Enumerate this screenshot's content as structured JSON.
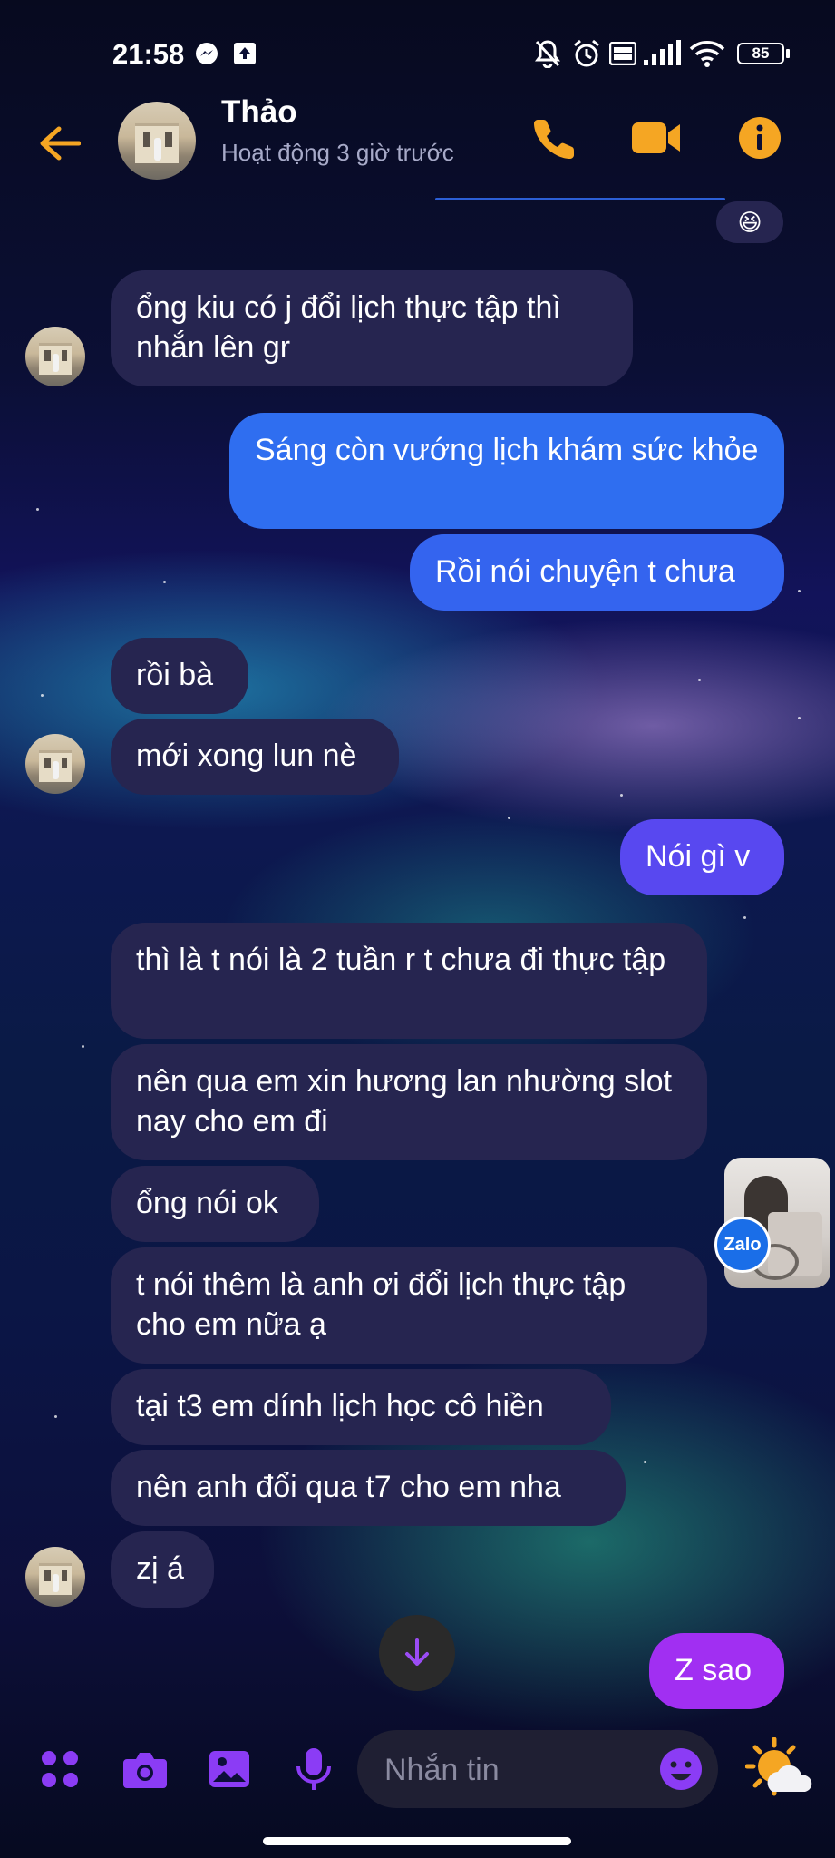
{
  "status_bar": {
    "time": "21:58",
    "icons": [
      "messenger-icon",
      "upload-icon",
      "bell-off-icon",
      "alarm-icon",
      "volte-icon",
      "signal-icon",
      "wifi-icon"
    ],
    "battery": "85"
  },
  "header": {
    "contact_name": "Thảo",
    "activity": "Hoạt động 3 giờ trước",
    "icons": [
      "back-arrow-icon",
      "phone-icon",
      "video-camera-icon",
      "info-icon"
    ],
    "accent_color": "#f5a623"
  },
  "messages": [
    {
      "side": "in",
      "text": "ổng kiu có j đổi lịch thực tập thì nhắn lên gr"
    },
    {
      "side": "out",
      "text": "Sáng còn vướng lịch khám sức khỏe"
    },
    {
      "side": "out",
      "text": "Rồi nói chuyện t chưa"
    },
    {
      "side": "in",
      "text": "rồi bà"
    },
    {
      "side": "in",
      "text": "mới xong lun nè"
    },
    {
      "side": "out",
      "text": "Nói gì v"
    },
    {
      "side": "in",
      "text": "thì là t nói là 2 tuần r t chưa đi thực tập"
    },
    {
      "side": "in",
      "text": "nên qua em xin hương lan nhường slot nay cho em đi"
    },
    {
      "side": "in",
      "text": "ổng nói ok"
    },
    {
      "side": "in",
      "text": "t nói thêm là anh ơi đổi lịch thực tập cho em nữa ạ"
    },
    {
      "side": "in",
      "text": "tại t3 em dính lịch học cô hiền"
    },
    {
      "side": "in",
      "text": "nên anh đổi qua t7 cho em nha"
    },
    {
      "side": "in",
      "text": "zị á"
    },
    {
      "side": "out",
      "text": "Z sao"
    }
  ],
  "reaction": "😆",
  "zalo_badge": "Zalo",
  "composer": {
    "placeholder": "Nhắn tin",
    "icons": [
      "apps-icon",
      "camera-icon",
      "image-icon",
      "microphone-icon",
      "emoji-icon",
      "weather-sun-cloud-icon"
    ]
  },
  "colors": {
    "incoming_bubble": "#262550",
    "outgoing_blue": "#2f6ef0",
    "outgoing_purple": "#7b3ff2",
    "outgoing_magenta": "#a12ff2",
    "composer_icon": "#8b3cf5"
  }
}
